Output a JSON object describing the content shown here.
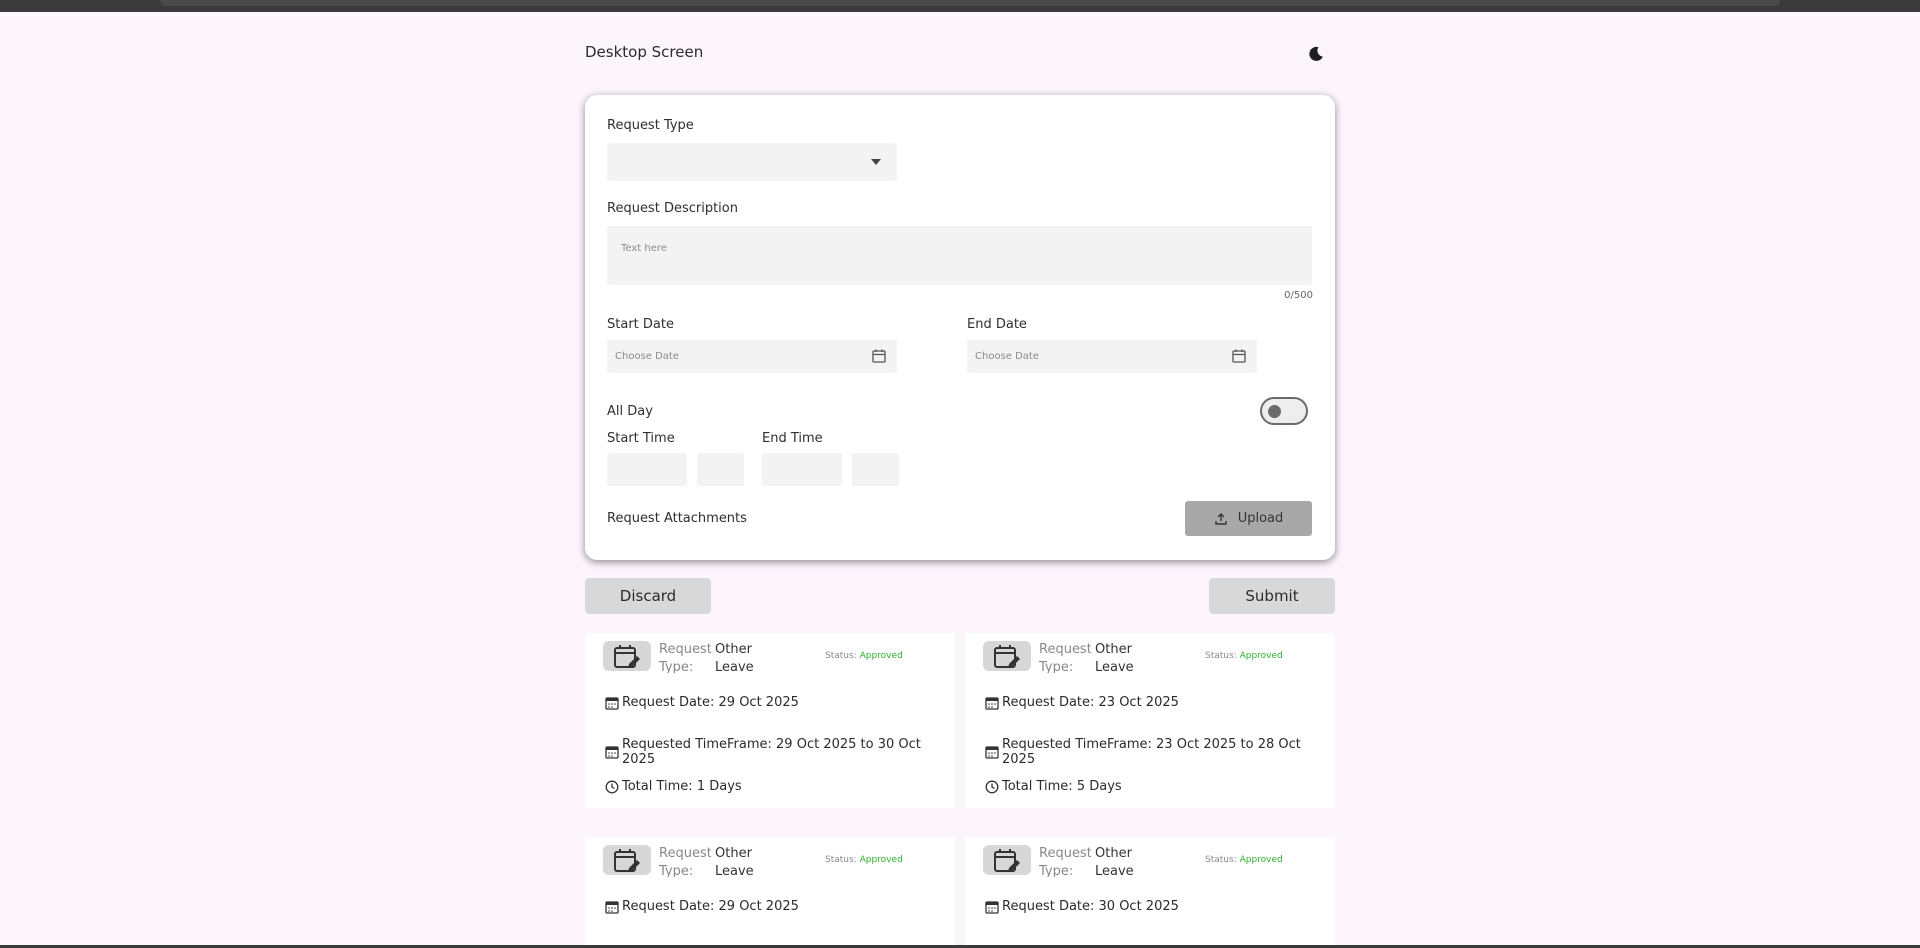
{
  "page": {
    "title": "Desktop Screen"
  },
  "form": {
    "request_type_label": "Request Type",
    "request_type_value": "",
    "request_description_label": "Request Description",
    "request_description_placeholder": "Text here",
    "char_counter": "0/500",
    "start_date_label": "Start Date",
    "start_date_placeholder": "Choose Date",
    "end_date_label": "End Date",
    "end_date_placeholder": "Choose Date",
    "all_day_label": "All Day",
    "all_day_on": false,
    "start_time_label": "Start Time",
    "end_time_label": "End Time",
    "attachments_label": "Request Attachments",
    "upload_label": "Upload"
  },
  "actions": {
    "discard_label": "Discard",
    "submit_label": "Submit"
  },
  "colors": {
    "background": "#fdf5fc",
    "status_approved": "#2fb12f",
    "button_bg": "#d8d8d8",
    "upload_bg": "#a8a8a8"
  },
  "requests": [
    {
      "type_label": "Request Type:",
      "type_value": "Other Leave",
      "status_label": "Status:",
      "status_value": "Approved",
      "request_date": "Request Date: 29 Oct 2025",
      "timeframe_prefix": "Requested Time",
      "timeframe_rest": "Frame: 29 Oct 2025 to 30 Oct 2025",
      "total_time": "Total Time: 1 Days"
    },
    {
      "type_label": "Request Type:",
      "type_value": "Other Leave",
      "status_label": "Status:",
      "status_value": "Approved",
      "request_date": "Request Date: 23 Oct 2025",
      "timeframe_prefix": "Requested Time",
      "timeframe_rest": "Frame: 23 Oct 2025 to 28 Oct 2025",
      "total_time": "Total Time: 5 Days"
    },
    {
      "type_label": "Request Type:",
      "type_value": "Other Leave",
      "status_label": "Status:",
      "status_value": "Approved",
      "request_date": "Request Date: 29 Oct 2025"
    },
    {
      "type_label": "Request Type:",
      "type_value": "Other Leave",
      "status_label": "Status:",
      "status_value": "Approved",
      "request_date": "Request Date: 30 Oct 2025"
    }
  ]
}
